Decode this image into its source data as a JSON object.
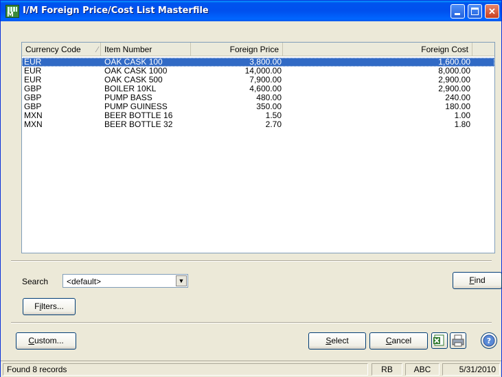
{
  "window": {
    "title": "I/M Foreign Price/Cost List Masterfile"
  },
  "list": {
    "columns": [
      "Currency Code",
      "Item Number",
      "Foreign Price",
      "Foreign Cost"
    ],
    "rows": [
      {
        "currency": "EUR",
        "item": "OAK CASK 100",
        "price": "3,800.00",
        "cost": "1,600.00",
        "selected": true
      },
      {
        "currency": "EUR",
        "item": "OAK CASK 1000",
        "price": "14,000.00",
        "cost": "8,000.00"
      },
      {
        "currency": "EUR",
        "item": "OAK CASK 500",
        "price": "7,900.00",
        "cost": "2,900.00"
      },
      {
        "currency": "GBP",
        "item": "BOILER 10KL",
        "price": "4,600.00",
        "cost": "2,900.00"
      },
      {
        "currency": "GBP",
        "item": "PUMP BASS",
        "price": "480.00",
        "cost": "240.00"
      },
      {
        "currency": "GBP",
        "item": "PUMP GUINESS",
        "price": "350.00",
        "cost": "180.00"
      },
      {
        "currency": "MXN",
        "item": "BEER BOTTLE 16",
        "price": "1.50",
        "cost": "1.00"
      },
      {
        "currency": "MXN",
        "item": "BEER BOTTLE 32",
        "price": "2.70",
        "cost": "1.80"
      }
    ]
  },
  "search": {
    "label": "Search",
    "value": "<default>"
  },
  "buttons": {
    "find": "Find",
    "filters": "Filters...",
    "custom": "Custom...",
    "select": "Select",
    "cancel": "Cancel"
  },
  "status": {
    "message": "Found 8 records",
    "user": "RB",
    "company": "ABC",
    "date": "5/31/2010"
  },
  "colors": {
    "selection": "#316ac5",
    "titlebar": "#0050ee"
  }
}
